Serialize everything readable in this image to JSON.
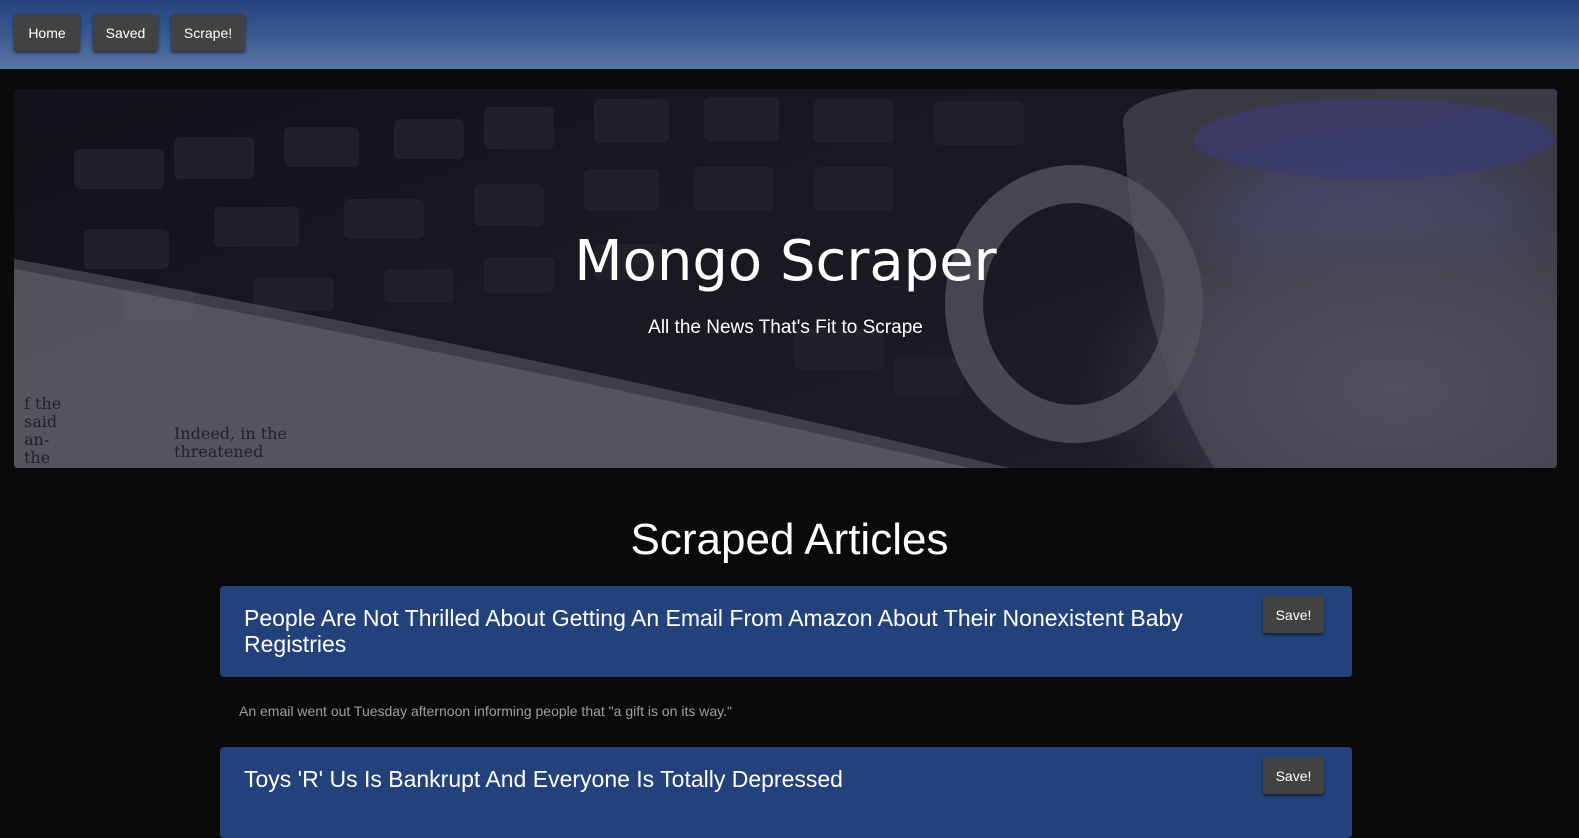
{
  "nav": {
    "home_label": "Home",
    "saved_label": "Saved",
    "scrape_label": "Scrape!"
  },
  "hero": {
    "title": "Mongo Scraper",
    "subtitle": "All the News That's Fit to Scrape"
  },
  "section": {
    "title": "Scraped Articles"
  },
  "articles": [
    {
      "title": "People Are Not Thrilled About Getting An Email From Amazon About Their Nonexistent Baby Registries",
      "summary": "An email went out Tuesday afternoon informing people that \"a gift is on its way.\"",
      "save_label": "Save!"
    },
    {
      "title": "Toys 'R' Us Is Bankrupt And Everyone Is Totally Depressed",
      "save_label": "Save!"
    }
  ],
  "colors": {
    "navbar": "#24427c",
    "card": "#23427b",
    "button": "#424242",
    "background": "#0a0a0a"
  }
}
